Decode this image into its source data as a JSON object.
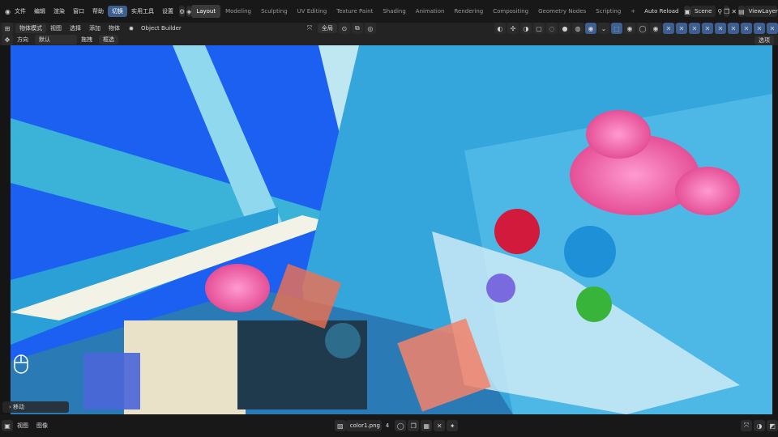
{
  "menu": {
    "items": [
      "文件",
      "编辑",
      "渲染",
      "窗口",
      "帮助",
      "切换",
      "实用工具",
      "设置"
    ],
    "active_index": 5
  },
  "workspace_tabs": [
    "Layout",
    "Modeling",
    "Sculpting",
    "UV Editing",
    "Texture Paint",
    "Shading",
    "Animation",
    "Rendering",
    "Compositing",
    "Geometry Nodes",
    "Scripting"
  ],
  "workspace_active": "Layout",
  "top_right": {
    "auto_reload": "Auto Reload",
    "scene": "Scene",
    "view_layer": "ViewLayer"
  },
  "header": {
    "mode": "物体模式",
    "view": "视图",
    "select": "选择",
    "add": "添加",
    "object": "物体",
    "addon": "Object Builder",
    "transform_orientation": "全局"
  },
  "tool_settings": {
    "orientation_label": "方向",
    "orientation_value": "默认",
    "drag_label": "拖拽",
    "drag_value": "框选",
    "options": "选项"
  },
  "operator_panel": {
    "label": "移动"
  },
  "bottom": {
    "view": "视图",
    "image": "图像",
    "filename": "color1.png",
    "slot_number": "4"
  },
  "colors": {
    "accent": "#3d5f8f",
    "sky": "#1b60f0",
    "viewport_cyan": "#3aa5d8"
  }
}
